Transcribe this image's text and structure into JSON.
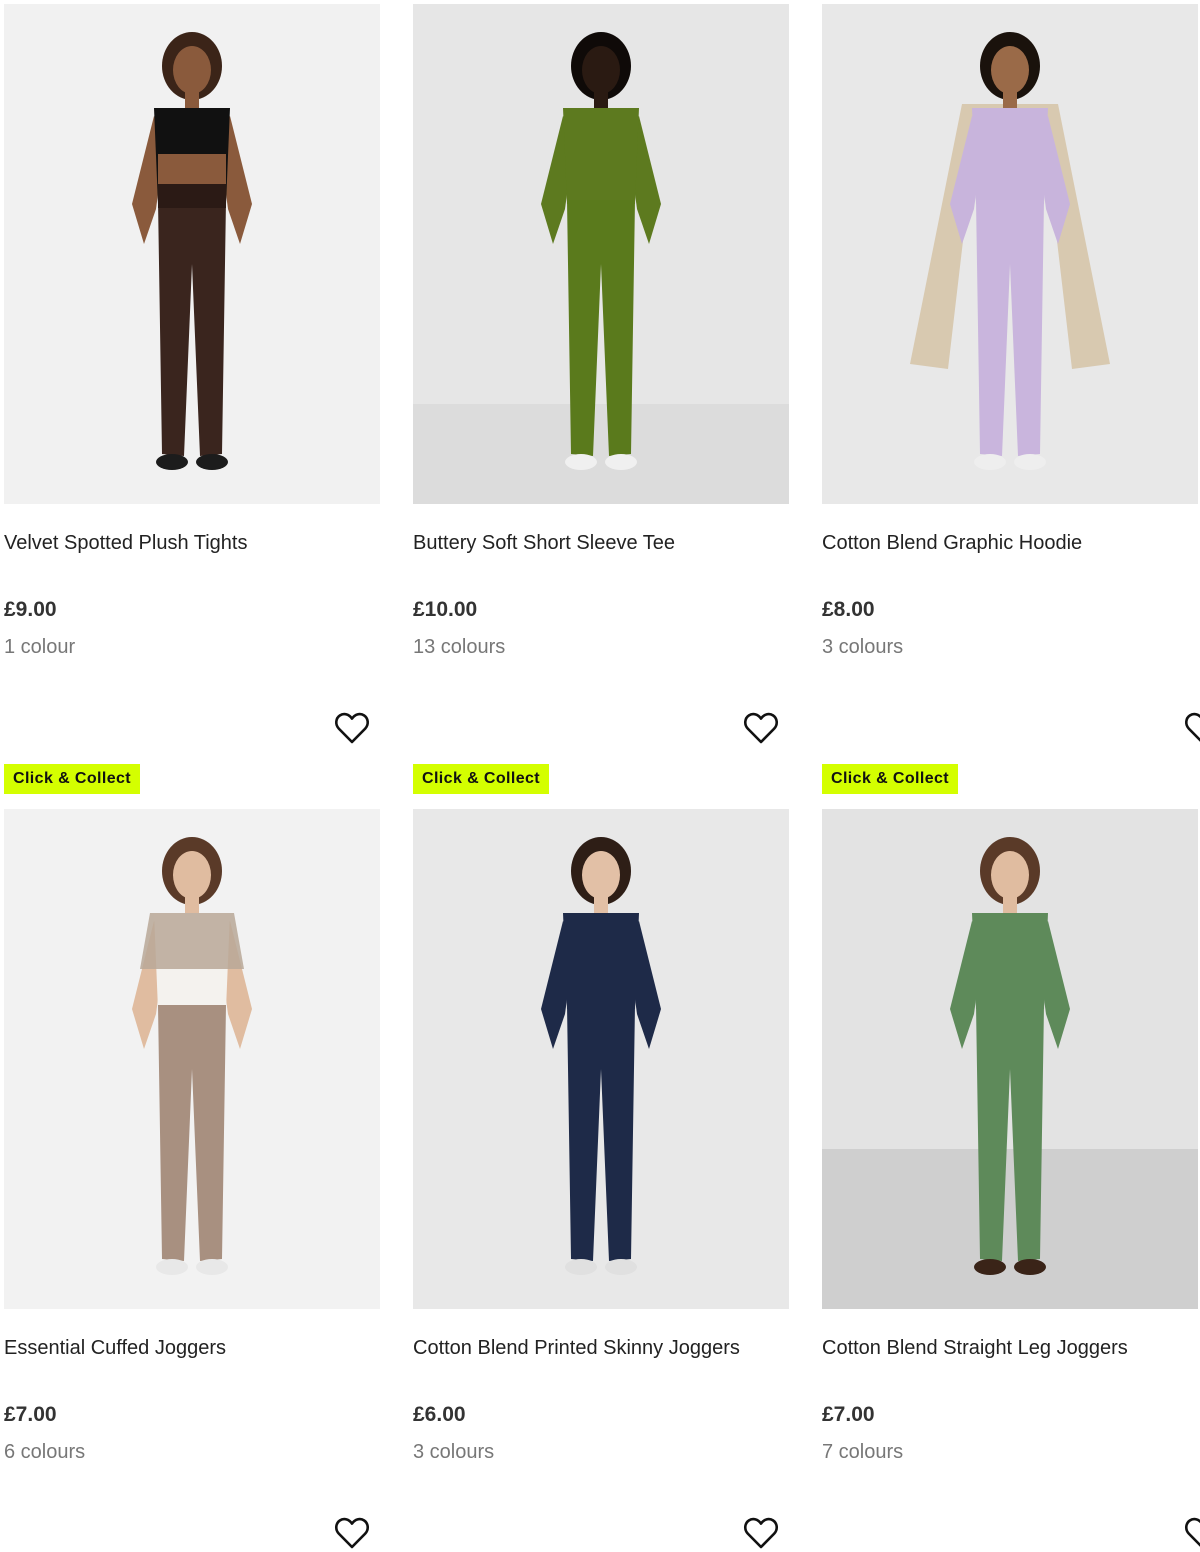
{
  "badge": {
    "label": "Click & Collect",
    "color": "#d4ff00"
  },
  "products": [
    {
      "title": "Velvet Spotted Plush Tights",
      "price": "£9.00",
      "colours": "1 colour",
      "image": {
        "top": "#111111",
        "bottom": "#3a251e",
        "extra": "#2b1a15",
        "skin": "#8a5a3c",
        "hair": "#3b2418",
        "shoes": "#1c1c1c",
        "bg": "#f1f1f1"
      }
    },
    {
      "title": "Buttery Soft Short Sleeve Tee",
      "price": "£10.00",
      "colours": "13 colours",
      "image": {
        "top": "#5d7a1f",
        "bottom": "#5a7a1c",
        "extra": "#5a7a1c",
        "skin": "#2a1a12",
        "hair": "#0f0a08",
        "shoes": "#f0f0f0",
        "bg": "#e6e6e6"
      }
    },
    {
      "title": "Cotton Blend Graphic Hoodie",
      "price": "£8.00",
      "colours": "3 colours",
      "image": {
        "top": "#c8b4dc",
        "bottom": "#c9b5dd",
        "extra": "#d8c9b0",
        "skin": "#9a6a48",
        "hair": "#1a120c",
        "shoes": "#eeeeee",
        "bg": "#e8e8e8"
      }
    },
    {
      "title": "Essential Cuffed Joggers",
      "price": "£7.00",
      "colours": "6 colours",
      "image": {
        "top": "#f4f2ee",
        "bottom": "#a89080",
        "extra": "#b8a898",
        "skin": "#e0bca0",
        "hair": "#5a3a28",
        "shoes": "#e8e8e8",
        "bg": "#f2f2f2"
      }
    },
    {
      "title": "Cotton Blend Printed Skinny Joggers",
      "price": "£6.00",
      "colours": "3 colours",
      "image": {
        "top": "#1e2a48",
        "bottom": "#1e2a48",
        "extra": "#1e2a48",
        "skin": "#e2c0a6",
        "hair": "#2e1e16",
        "shoes": "#e0e0e0",
        "bg": "#e8e8e8"
      }
    },
    {
      "title": "Cotton Blend Straight Leg Joggers",
      "price": "£7.00",
      "colours": "7 colours",
      "image": {
        "top": "#5e8a5a",
        "bottom": "#5e8a5a",
        "extra": "#dbe8e6",
        "skin": "#e0bca0",
        "hair": "#5a3a28",
        "shoes": "#3a2418",
        "bg": "#e3e3e3"
      }
    }
  ]
}
